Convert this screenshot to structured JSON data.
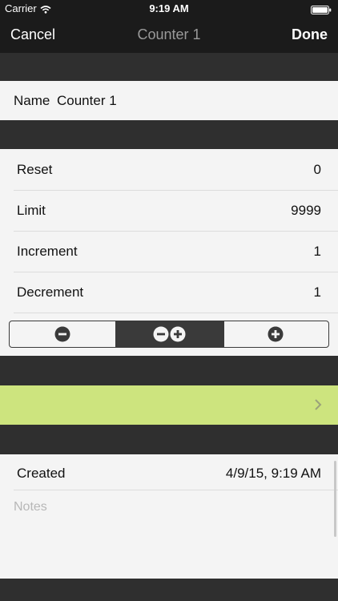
{
  "status_bar": {
    "carrier": "Carrier",
    "time": "9:19 AM",
    "wifi_icon": "wifi-icon",
    "battery_icon": "battery-icon"
  },
  "nav": {
    "cancel_label": "Cancel",
    "title": "Counter 1",
    "done_label": "Done"
  },
  "name_field": {
    "label": "Name",
    "value": "Counter 1"
  },
  "settings": {
    "rows": [
      {
        "label": "Reset",
        "value": "0"
      },
      {
        "label": "Limit",
        "value": "9999"
      },
      {
        "label": "Increment",
        "value": "1"
      },
      {
        "label": "Decrement",
        "value": "1"
      }
    ]
  },
  "mode_control": {
    "segments": [
      {
        "icon": "minus-icon"
      },
      {
        "icon": "minus-plus-icon",
        "selected": true
      },
      {
        "icon": "plus-icon"
      }
    ]
  },
  "color_row": {
    "color": "#cde47e",
    "icon": "chevron-right-icon"
  },
  "info": {
    "created_label": "Created",
    "created_value": "4/9/15, 9:19 AM",
    "notes_placeholder": "Notes"
  },
  "colors": {
    "nav_background": "#1b1b1b",
    "section_background": "#2f2f2f",
    "panel_background": "#f4f4f4",
    "accent_green": "#cde47e"
  }
}
